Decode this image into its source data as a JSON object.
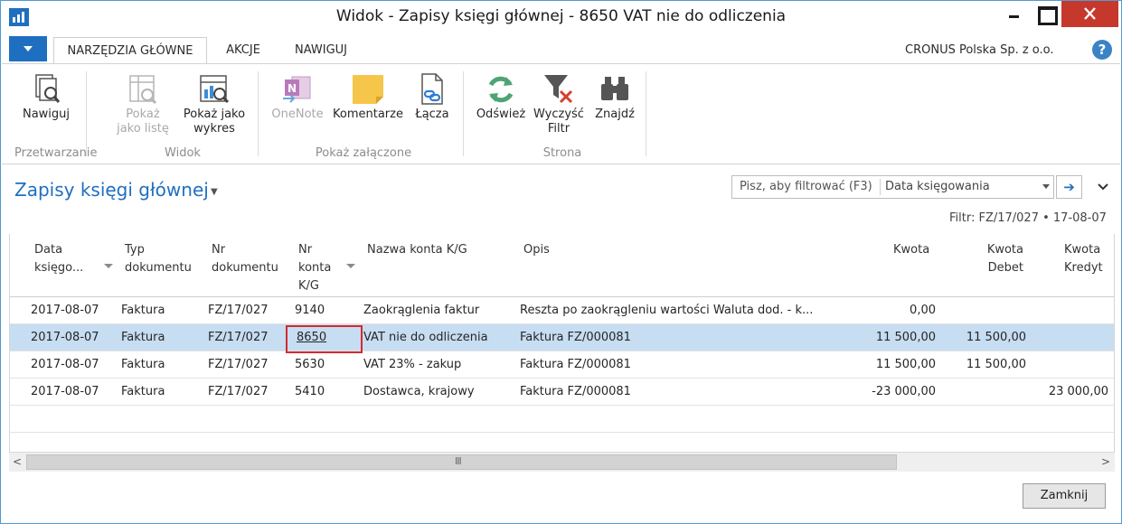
{
  "window": {
    "title": "Widok - Zapisy księgi głównej - 8650 VAT nie do odliczenia"
  },
  "ribbon_tabs": {
    "main": "NARZĘDZIA GŁÓWNE",
    "actions": "AKCJE",
    "navigate": "NAWIGUJ"
  },
  "company": "CRONUS Polska Sp. z o.o.",
  "ribbon": {
    "navigate": "Nawiguj",
    "show_list_1": "Pokaż",
    "show_list_2": "jako listę",
    "show_chart_1": "Pokaż jako",
    "show_chart_2": "wykres",
    "onenote": "OneNote",
    "comments": "Komentarze",
    "links": "Łącza",
    "refresh": "Odśwież",
    "clear_filter_1": "Wyczyść",
    "clear_filter_2": "Filtr",
    "find": "Znajdź",
    "group_processing": "Przetwarzanie",
    "group_view": "Widok",
    "group_attached": "Pokaż załączone",
    "group_page": "Strona"
  },
  "page": {
    "title": "Zapisy księgi głównej",
    "filter_placeholder": "Pisz, aby filtrować (F3)",
    "filter_field": "Data księgowania",
    "filter_info": "Filtr: FZ/17/027 • 17-08-07"
  },
  "columns": {
    "posting_date_1": "Data",
    "posting_date_2": "księgo...",
    "doc_type_1": "Typ",
    "doc_type_2": "dokumentu",
    "doc_no_1": "Nr",
    "doc_no_2": "dokumentu",
    "acc_no_1": "Nr",
    "acc_no_2": "konta",
    "acc_no_3": "K/G",
    "acc_name": "Nazwa konta K/G",
    "description": "Opis",
    "amount": "Kwota",
    "debit_1": "Kwota",
    "debit_2": "Debet",
    "credit_1": "Kwota",
    "credit_2": "Kredyt"
  },
  "rows": [
    {
      "date": "2017-08-07",
      "type": "Faktura",
      "doc": "FZ/17/027",
      "acc": "9140",
      "name": "Zaokrąglenia faktur",
      "desc": "Reszta po zaokrągleniu wartości Waluta dod. - k...",
      "amount": "0,00",
      "debit": "",
      "credit": ""
    },
    {
      "date": "2017-08-07",
      "type": "Faktura",
      "doc": "FZ/17/027",
      "acc": "8650",
      "name": "VAT nie do odliczenia",
      "desc": "Faktura FZ/000081",
      "amount": "11 500,00",
      "debit": "11 500,00",
      "credit": ""
    },
    {
      "date": "2017-08-07",
      "type": "Faktura",
      "doc": "FZ/17/027",
      "acc": "5630",
      "name": "VAT 23% - zakup",
      "desc": "Faktura FZ/000081",
      "amount": "11 500,00",
      "debit": "11 500,00",
      "credit": ""
    },
    {
      "date": "2017-08-07",
      "type": "Faktura",
      "doc": "FZ/17/027",
      "acc": "5410",
      "name": "Dostawca, krajowy",
      "desc": "Faktura FZ/000081",
      "amount": "-23 000,00",
      "debit": "",
      "credit": "23 000,00"
    }
  ],
  "footer": {
    "close": "Zamknij"
  }
}
